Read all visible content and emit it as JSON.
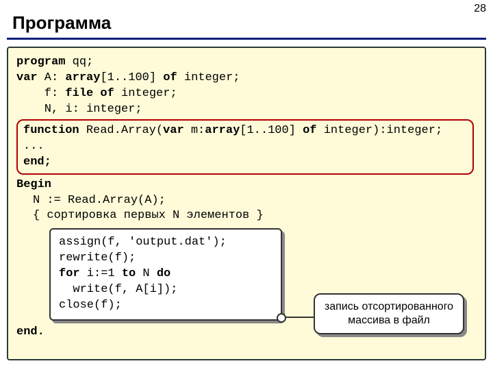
{
  "page_number": "28",
  "title": "Программа",
  "code": {
    "l1a": "program",
    "l1b": " qq;",
    "l2a": "var",
    "l2b": " A: ",
    "l2c": "array",
    "l2d": "[1..100] ",
    "l2e": "of",
    "l2f": " integer;",
    "l3a": "    f: ",
    "l3b": "file of",
    "l3c": " integer;",
    "l4": "    N, i: integer;",
    "fn1a": "function",
    "fn1b": " Read.Array(",
    "fn1c": "var",
    "fn1d": " m:",
    "fn1e": "array",
    "fn1f": "[1..100] ",
    "fn1g": "of",
    "fn1h": " integer):integer;",
    "fn2": "...",
    "fn3": "end;",
    "l5": "Begin",
    "l6": "N := Read.Array(A);",
    "l7": "{ сортировка первых N элементов }",
    "i1": "assign(f, 'output.dat');",
    "i2": "rewrite(f);",
    "i3a": "for",
    "i3b": " i:=1 ",
    "i3c": "to",
    "i3d": " N ",
    "i3e": "do",
    "i4": "  write(f, A[i]);",
    "i5": "close(f);",
    "l8": "end."
  },
  "callout": {
    "line1": "запись отсортированного",
    "line2": "массива в файл"
  }
}
